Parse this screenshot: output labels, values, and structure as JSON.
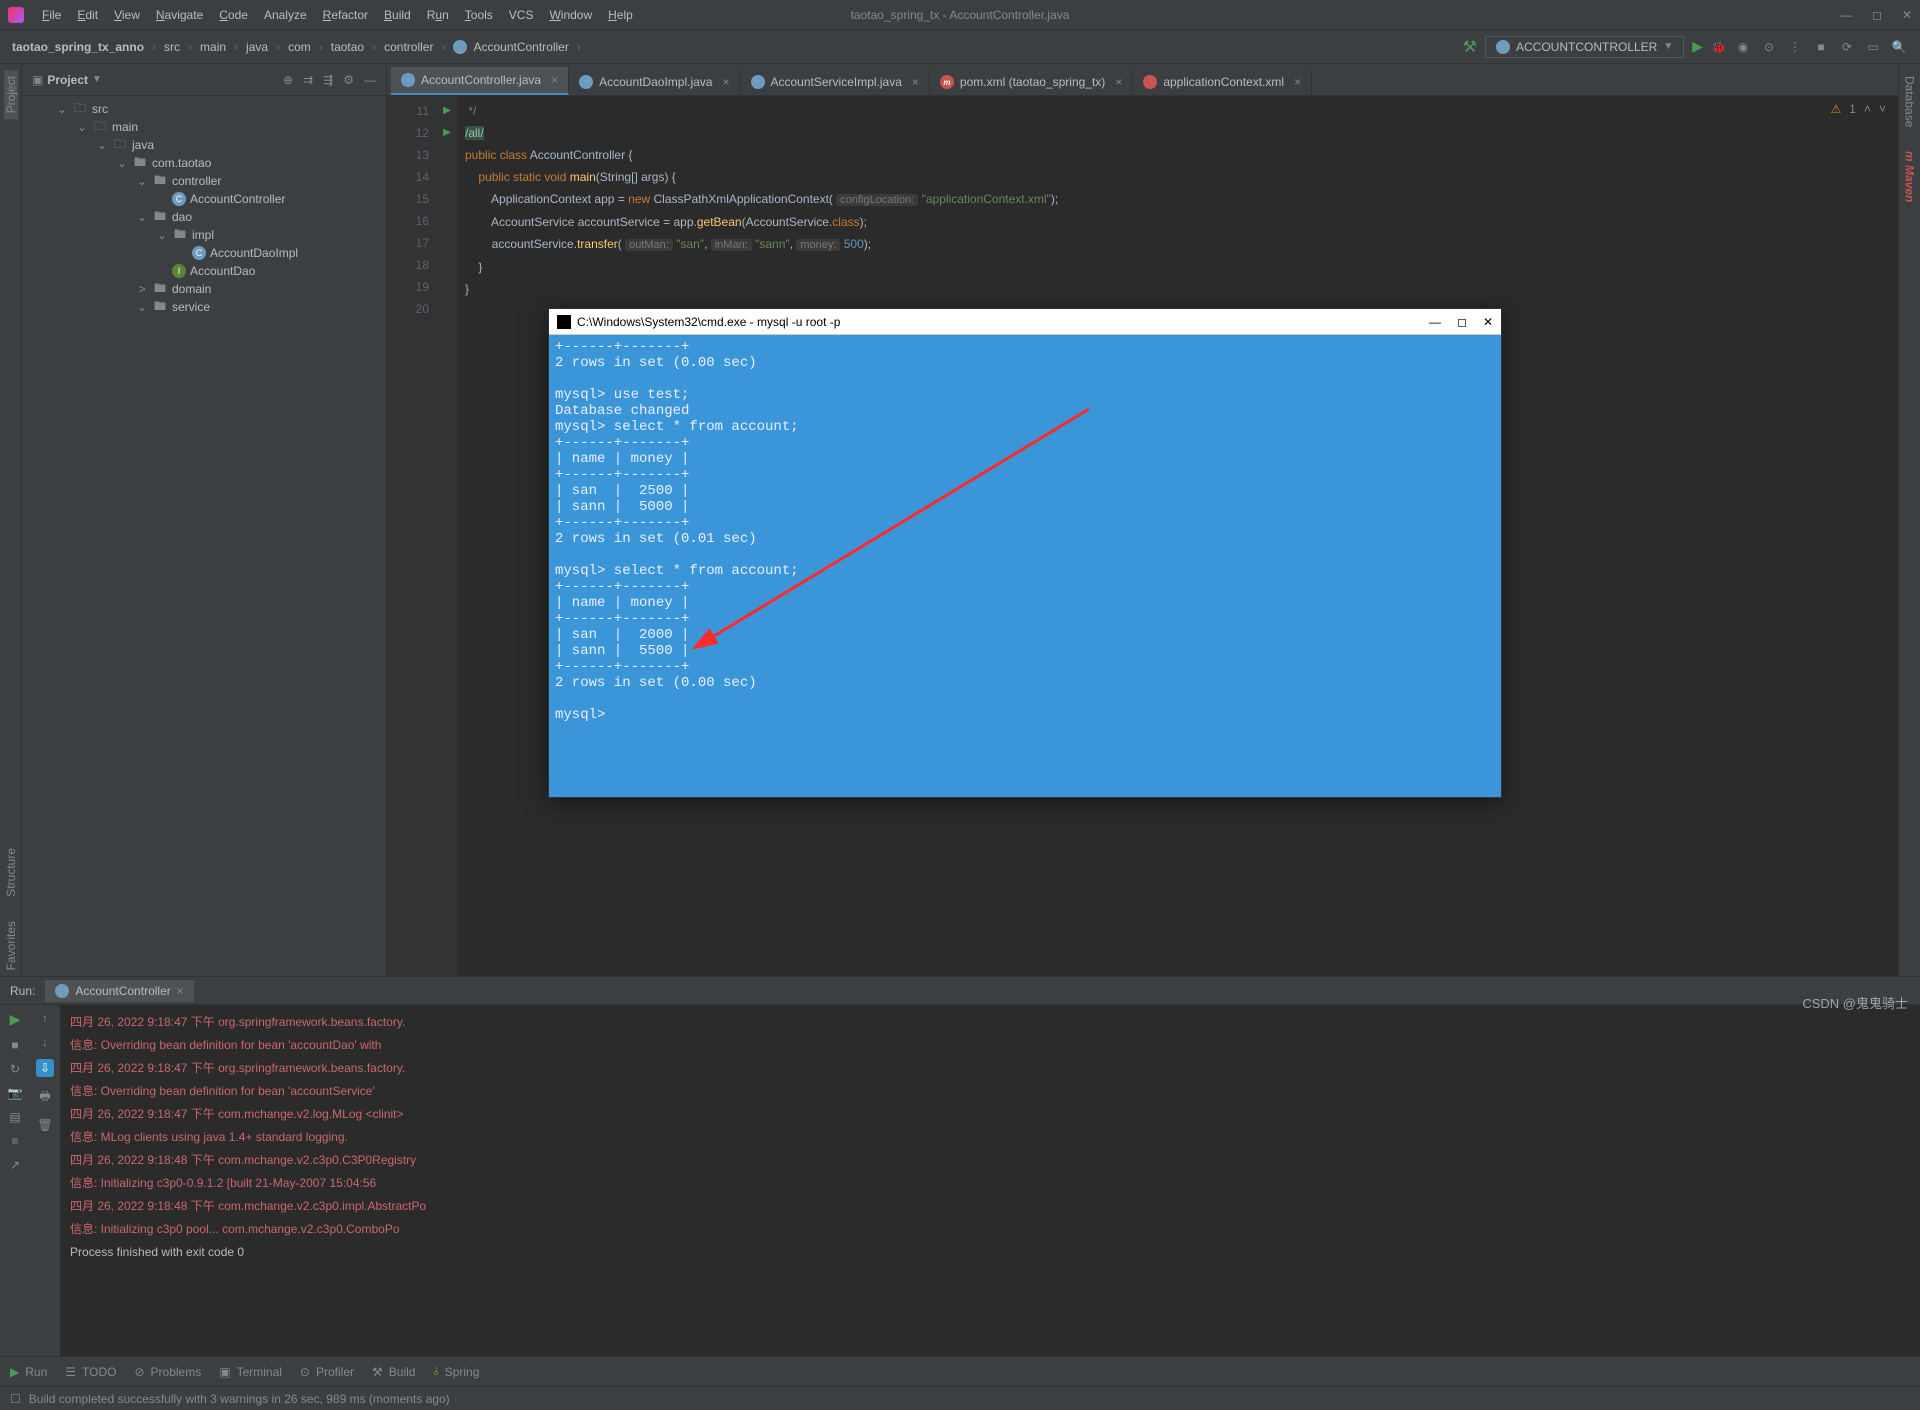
{
  "menu": {
    "file": "File",
    "edit": "Edit",
    "view": "View",
    "navigate": "Navigate",
    "code": "Code",
    "analyze": "Analyze",
    "refactor": "Refactor",
    "build": "Build",
    "run": "Run",
    "tools": "Tools",
    "vcs": "VCS",
    "window": "Window",
    "help": "Help"
  },
  "window_title": "taotao_spring_tx - AccountController.java",
  "breadcrumb": {
    "items": [
      "taotao_spring_tx_anno",
      "src",
      "main",
      "java",
      "com",
      "taotao",
      "controller",
      "AccountController"
    ]
  },
  "run_config": "ACCOUNTCONTROLLER",
  "project": {
    "label": "Project",
    "tree": [
      {
        "indent": 34,
        "arrow": "⌄",
        "icon": "folder",
        "label": "src"
      },
      {
        "indent": 54,
        "arrow": "⌄",
        "icon": "folder",
        "label": "main"
      },
      {
        "indent": 74,
        "arrow": "⌄",
        "icon": "folder",
        "label": "java"
      },
      {
        "indent": 94,
        "arrow": "⌄",
        "icon": "pkg",
        "label": "com.taotao"
      },
      {
        "indent": 114,
        "arrow": "⌄",
        "icon": "pkg",
        "label": "controller"
      },
      {
        "indent": 134,
        "arrow": "",
        "icon": "cls",
        "label": "AccountController"
      },
      {
        "indent": 114,
        "arrow": "⌄",
        "icon": "pkg",
        "label": "dao"
      },
      {
        "indent": 134,
        "arrow": "⌄",
        "icon": "pkg",
        "label": "impl"
      },
      {
        "indent": 154,
        "arrow": "",
        "icon": "cls",
        "label": "AccountDaoImpl"
      },
      {
        "indent": 134,
        "arrow": "",
        "icon": "iface",
        "label": "AccountDao"
      },
      {
        "indent": 114,
        "arrow": ">",
        "icon": "pkg",
        "label": "domain"
      },
      {
        "indent": 114,
        "arrow": "⌄",
        "icon": "pkg",
        "label": "service"
      }
    ]
  },
  "tabs": [
    {
      "icon": "java",
      "label": "AccountController.java",
      "active": true
    },
    {
      "icon": "java",
      "label": "AccountDaoImpl.java"
    },
    {
      "icon": "java",
      "label": "AccountServiceImpl.java"
    },
    {
      "icon": "xml",
      "label": "pom.xml (taotao_spring_tx)",
      "iconText": "m"
    },
    {
      "icon": "xml",
      "label": "applicationContext.xml"
    }
  ],
  "editor": {
    "warnings": "1",
    "lines": [
      {
        "n": "11",
        "html": " <span class='comment'>*/</span>"
      },
      {
        "n": "12",
        "html": "<span class='comment' style='background:#32593d;color:#a9b7c6;'>/all/</span>"
      },
      {
        "n": "13",
        "icon": "▶",
        "html": "<span class='kw'>public class</span> <span class='cls-name'>AccountController</span> {"
      },
      {
        "n": "14",
        "icon": "▶",
        "html": "    <span class='kw'>public static void</span> <span class='method'>main</span>(<span class='type'>String</span>[] <span class='param'>args</span>) {"
      },
      {
        "n": "15",
        "html": "        <span class='type'>ApplicationContext</span> <span class='param'>app</span> = <span class='kw'>new</span> <span class='type'>ClassPathXmlApplicationContext</span>( <span class='hint'>configLocation:</span> <span class='str'>\"applicationContext.xml\"</span>);"
      },
      {
        "n": "16",
        "html": "        <span class='type'>AccountService</span> <span class='param'>accountService</span> = <span class='param'>app</span>.<span class='method'>getBean</span>(<span class='type'>AccountService</span>.<span class='kw'>class</span>);"
      },
      {
        "n": "17",
        "html": "        <span class='param'>accountService</span>.<span class='method'>transfer</span>( <span class='hint'>outMan:</span> <span class='str'>\"san\"</span>, <span class='hint'>inMan:</span> <span class='str'>\"sann\"</span>, <span class='hint'>money:</span> <span class='num'>500</span>);"
      },
      {
        "n": "18",
        "html": "    }"
      },
      {
        "n": "19",
        "html": "}"
      },
      {
        "n": "20",
        "html": ""
      }
    ]
  },
  "run": {
    "label": "Run:",
    "tab": "AccountController",
    "console": [
      {
        "cls": "red",
        "text": "四月 26, 2022 9:18:47 下午 org.springframework.beans.factory."
      },
      {
        "cls": "red",
        "text": "信息: Overriding bean definition for bean 'accountDao' with"
      },
      {
        "cls": "red",
        "text": "四月 26, 2022 9:18:47 下午 org.springframework.beans.factory."
      },
      {
        "cls": "red",
        "text": "信息: Overriding bean definition for bean 'accountService' "
      },
      {
        "cls": "red",
        "text": "四月 26, 2022 9:18:47 下午 com.mchange.v2.log.MLog <clinit>"
      },
      {
        "cls": "red",
        "text": "信息: MLog clients using java 1.4+ standard logging."
      },
      {
        "cls": "red",
        "text": "四月 26, 2022 9:18:48 下午 com.mchange.v2.c3p0.C3P0Registry"
      },
      {
        "cls": "red",
        "text": "信息: Initializing c3p0-0.9.1.2 [built 21-May-2007 15:04:56"
      },
      {
        "cls": "red",
        "text": "四月 26, 2022 9:18:48 下午 com.mchange.v2.c3p0.impl.AbstractPo"
      },
      {
        "cls": "red",
        "text": "信息: Initializing c3p0 pool... com.mchange.v2.c3p0.ComboPo"
      },
      {
        "cls": "normal",
        "text": " "
      },
      {
        "cls": "normal",
        "text": "Process finished with exit code 0"
      }
    ]
  },
  "bottom": {
    "run": "Run",
    "todo": "TODO",
    "problems": "Problems",
    "terminal": "Terminal",
    "profiler": "Profiler",
    "build": "Build",
    "spring": "Spring"
  },
  "status": "Build completed successfully with 3 warnings in 26 sec, 989 ms (moments ago)",
  "sidebar_left": {
    "project": "Project",
    "structure": "Structure",
    "favorites": "Favorites"
  },
  "sidebar_right": {
    "database": "Database",
    "maven": "Maven"
  },
  "cmd": {
    "title": "C:\\Windows\\System32\\cmd.exe - mysql  -u root -p",
    "body": "+------+-------+\n2 rows in set (0.00 sec)\n\nmysql> use test;\nDatabase changed\nmysql> select * from account;\n+------+-------+\n| name | money |\n+------+-------+\n| san  |  2500 |\n| sann |  5000 |\n+------+-------+\n2 rows in set (0.01 sec)\n\nmysql> select * from account;\n+------+-------+\n| name | money |\n+------+-------+\n| san  |  2000 |\n| sann |  5500 |\n+------+-------+\n2 rows in set (0.00 sec)\n\nmysql> "
  },
  "watermark": "CSDN @鬼鬼骑士"
}
